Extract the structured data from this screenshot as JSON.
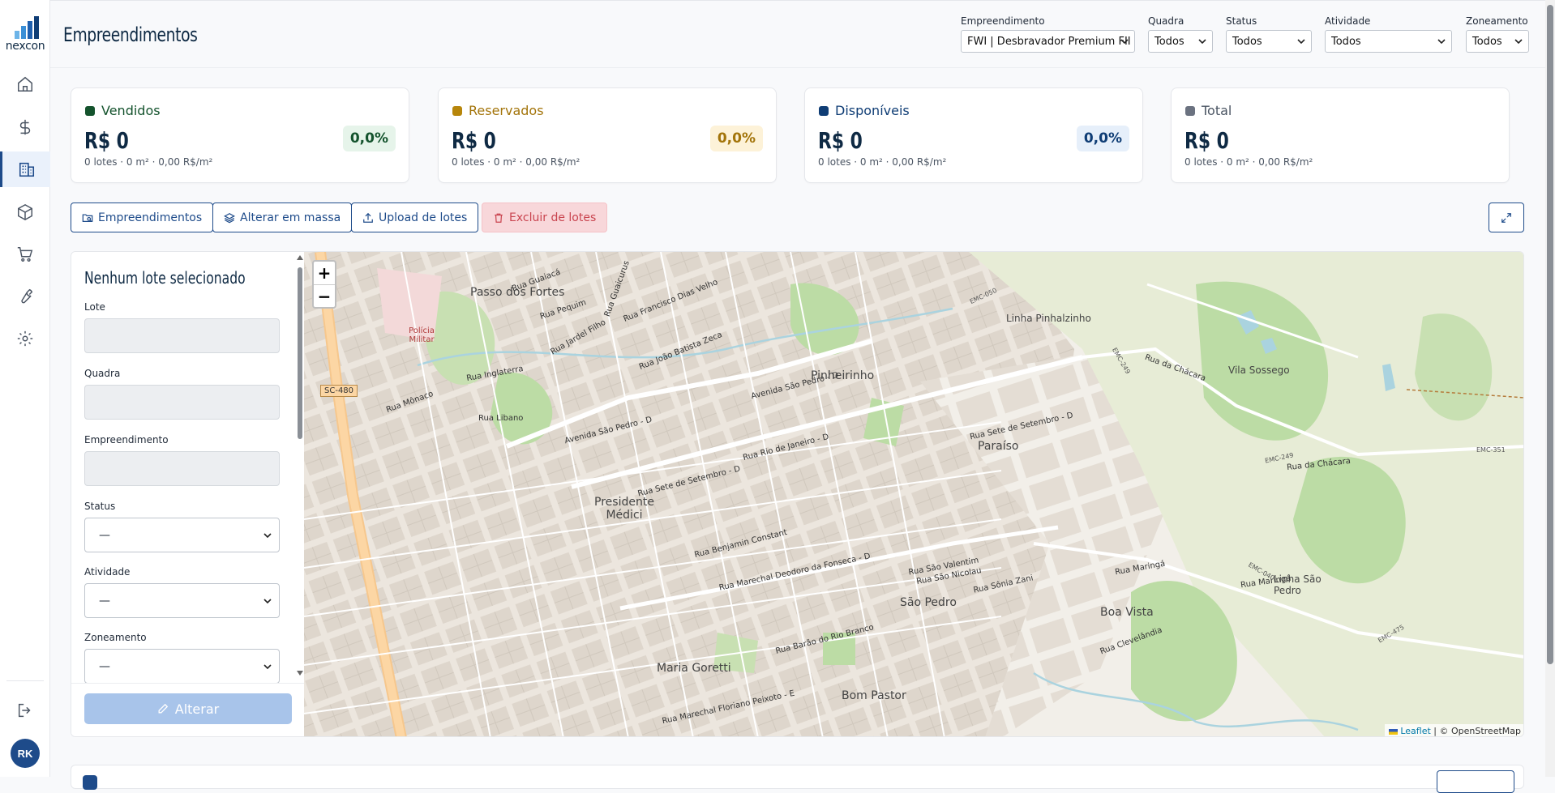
{
  "app": {
    "logo_text": "nexcon",
    "user_initials": "RK"
  },
  "header": {
    "title": "Empreendimentos"
  },
  "filters": [
    {
      "label": "Empreendimento",
      "value": "FWI | Desbravador Premium FII"
    },
    {
      "label": "Quadra",
      "value": "Todos"
    },
    {
      "label": "Status",
      "value": "Todos"
    },
    {
      "label": "Atividade",
      "value": "Todos"
    },
    {
      "label": "Zoneamento",
      "value": "Todos"
    }
  ],
  "summary_cards": [
    {
      "title": "Vendidos",
      "value": "R$ 0",
      "percent": "0,0%",
      "details": "0 lotes · 0 m² · 0,00 R$/m²",
      "color": "#14532d",
      "title_color": "#14532d",
      "pct_bg": "#e6f4ea",
      "pct_color": "#14532d"
    },
    {
      "title": "Reservados",
      "value": "R$ 0",
      "percent": "0,0%",
      "details": "0 lotes · 0 m² · 0,00 R$/m²",
      "color": "#b7860b",
      "title_color": "#a3740a",
      "pct_bg": "#fdf2d8",
      "pct_color": "#a3740a"
    },
    {
      "title": "Disponíveis",
      "value": "R$ 0",
      "percent": "0,0%",
      "details": "0 lotes · 0 m² · 0,00 R$/m²",
      "color": "#0f3d75",
      "title_color": "#0f3d75",
      "pct_bg": "#e6effa",
      "pct_color": "#0f3d75"
    },
    {
      "title": "Total",
      "value": "R$ 0",
      "percent": "",
      "details": "0 lotes · 0 m² · 0,00 R$/m²",
      "color": "#6b7280",
      "title_color": "#4b5563",
      "pct_bg": "",
      "pct_color": ""
    }
  ],
  "actions": {
    "empreendimentos": "Empreendimentos",
    "alterar_massa": "Alterar em massa",
    "upload": "Upload de lotes",
    "excluir": "Excluir de lotes"
  },
  "lot_form": {
    "title": "Nenhum lote selecionado",
    "lote_label": "Lote",
    "quadra_label": "Quadra",
    "empreendimento_label": "Empreendimento",
    "status_label": "Status",
    "status_value": "—",
    "atividade_label": "Atividade",
    "atividade_value": "—",
    "zoneamento_label": "Zoneamento",
    "zoneamento_value": "—",
    "submit_label": "Alterar"
  },
  "map": {
    "zoom_in": "+",
    "zoom_out": "−",
    "attribution_leaflet": "Leaflet",
    "attribution_rest": "| © OpenStreetMap",
    "place_labels": [
      "Passo dos Fortes",
      "Pinheirinho",
      "Linha Pinhalzinho",
      "Vila Sossego",
      "Paraíso",
      "Presidente Médici",
      "São Pedro",
      "Boa Vista",
      "Linha São Pedro",
      "Maria Goretti",
      "Bom Pastor",
      "Polícia Militar"
    ],
    "street_labels": [
      "Avenida São Pedro - D",
      "Rua Sete de Setembro - D",
      "Rua Rio de Janeiro - D",
      "Rua Marechal Deodoro da Fonseca - D",
      "Rua Benjamin Constant",
      "Rua Marechal Floriano Peixoto - E",
      "Rua Barão do Rio Branco",
      "Rua Inglaterra",
      "Rua Mônaco",
      "Rua Libano",
      "Rua Guaicurus",
      "Rua Maringá",
      "Rua Clevelândia",
      "Rua da Chácara",
      "Rua Sônia Zani",
      "Rua São Valentim",
      "Rua São Nicolau",
      "Rua Francisco Dias Velho",
      "Rua João Batista Zeca",
      "Rua Jardel Filho",
      "Rua Pequim",
      "Rua Guaiacá"
    ],
    "road_badges": [
      "SC-480",
      "EMC-050",
      "EMC-249",
      "EMC-351",
      "EMC-040",
      "EMC-475"
    ]
  }
}
